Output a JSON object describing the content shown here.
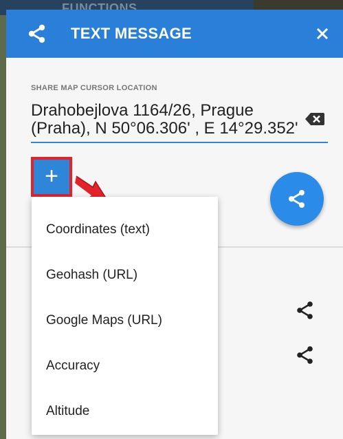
{
  "background": {
    "title": "FUNCTIONS"
  },
  "dialog": {
    "title": "TEXT MESSAGE",
    "share_icon": "share-icon",
    "close_icon": "close-icon",
    "header_color": "#2a7fd8"
  },
  "field": {
    "label": "SHARE MAP CURSOR LOCATION",
    "value": "Drahobejlova 1164/26, Prague\n(Praha), N 50°06.306' , E 14°29.352'",
    "clear_icon": "backspace-icon"
  },
  "add_button": {
    "label": "+",
    "highlight_color": "#e2242a"
  },
  "menu": {
    "items": [
      {
        "label": "Coordinates (text)"
      },
      {
        "label": "Geohash (URL)"
      },
      {
        "label": "Google Maps (URL)"
      },
      {
        "label": "Accuracy"
      },
      {
        "label": "Altitude"
      }
    ]
  },
  "accent_color": "#2f86d8"
}
